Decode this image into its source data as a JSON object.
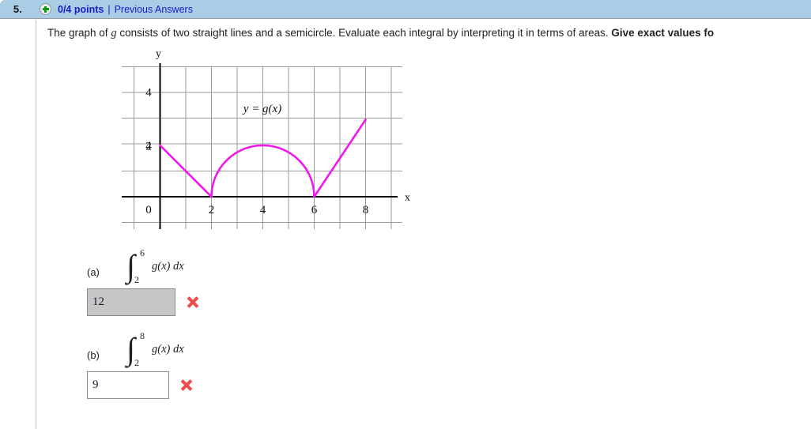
{
  "header": {
    "question_number": "5.",
    "plus_icon": "plus-circle-icon",
    "points": "0/4 points",
    "separator": "|",
    "previous_answers": "Previous Answers"
  },
  "question": {
    "prompt_part1": "The graph of ",
    "prompt_var": "g",
    "prompt_part2": " consists of two straight lines and a semicircle. Evaluate each integral by interpreting it in terms of areas. ",
    "prompt_bold": "Give exact values fo"
  },
  "graph": {
    "curve_label": "y = g(x)",
    "x_axis_label": "x",
    "y_axis_label": "y",
    "x_ticks": [
      "0",
      "2",
      "4",
      "6",
      "8"
    ],
    "y_ticks": [
      "2",
      "4"
    ],
    "curve_color": "#ef18ef",
    "grid_color": "#9a9a9a",
    "axis_color": "#000000"
  },
  "chart_data": {
    "type": "line",
    "title": "",
    "xlabel": "x",
    "ylabel": "y",
    "xlim": [
      -1,
      9.5
    ],
    "ylim": [
      -1,
      5.2
    ],
    "grid": true,
    "legend": "y = g(x)",
    "series": [
      {
        "name": "straight line segment 1",
        "x": [
          0,
          2
        ],
        "y": [
          2,
          0
        ]
      },
      {
        "name": "semicircle (center x=4, radius 2)",
        "x": [
          2,
          2.5,
          3,
          3.5,
          4,
          4.5,
          5,
          5.5,
          6
        ],
        "y": [
          0,
          1.32,
          1.73,
          1.94,
          2,
          1.94,
          1.73,
          1.32,
          0
        ]
      },
      {
        "name": "straight line segment 2",
        "x": [
          6,
          8
        ],
        "y": [
          0,
          3
        ]
      }
    ]
  },
  "parts": [
    {
      "label": "(a)",
      "integral_sign": "∫",
      "upper_limit": "6",
      "lower_limit": "2",
      "integrand": "g(x) dx",
      "answer_value": "12",
      "box_state": "disabled",
      "status_icon": "x-mark-incorrect-icon"
    },
    {
      "label": "(b)",
      "integral_sign": "∫",
      "upper_limit": "8",
      "lower_limit": "2",
      "integrand": "g(x) dx",
      "answer_value": "9",
      "box_state": "normal",
      "status_icon": "x-mark-incorrect-icon"
    }
  ]
}
